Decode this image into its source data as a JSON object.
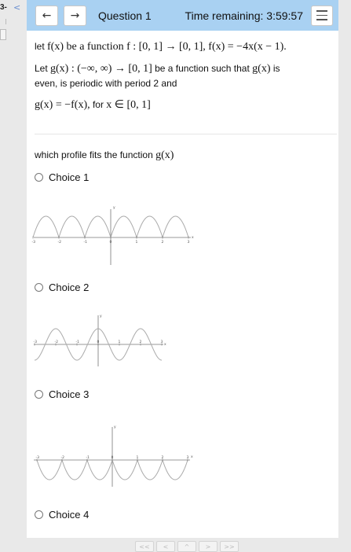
{
  "side": {
    "question_number": "3-",
    "back_glyph": "<"
  },
  "header": {
    "prev_glyph": "←",
    "next_glyph": "→",
    "title": "Question 1",
    "timer": "Time remaining: 3:59:57"
  },
  "question": {
    "line1_text": "let ",
    "line1_math": "f(x) be a function f : [0, 1] → [0, 1], f(x) = −4x(x − 1).",
    "line2_text_a": "Let ",
    "line2_math": "g(x) : (−∞, ∞) → [0, 1]",
    "line2_text_b": " be a function such that ",
    "line2_math_b": "g(x)",
    "line2_text_c": " is",
    "line3_text": "even, is periodic with period 2 and",
    "line4_math": "g(x) = −f(x),",
    "line4_text": " for ",
    "line4_math_b": "x ∈ [0, 1]",
    "prompt_text": "which profile fits the function ",
    "prompt_math": "g(x)"
  },
  "choices": [
    {
      "label": "Choice 1"
    },
    {
      "label": "Choice 2"
    },
    {
      "label": "Choice 3"
    },
    {
      "label": "Choice 4"
    }
  ],
  "graph_axis_labels": {
    "x": "x",
    "y": "y"
  },
  "graph1_ticks": [
    "-3",
    "-2",
    "-1",
    "0",
    "1",
    "2",
    "3"
  ],
  "graph2_ticks": [
    "-3",
    "-2",
    "-1",
    "0",
    "1",
    "2",
    "3"
  ],
  "graph3_ticks": [
    "-3",
    "-2",
    "-1",
    "0",
    "1",
    "2",
    "3"
  ],
  "pager": [
    "<<",
    "<",
    "^",
    ">",
    ">>"
  ]
}
